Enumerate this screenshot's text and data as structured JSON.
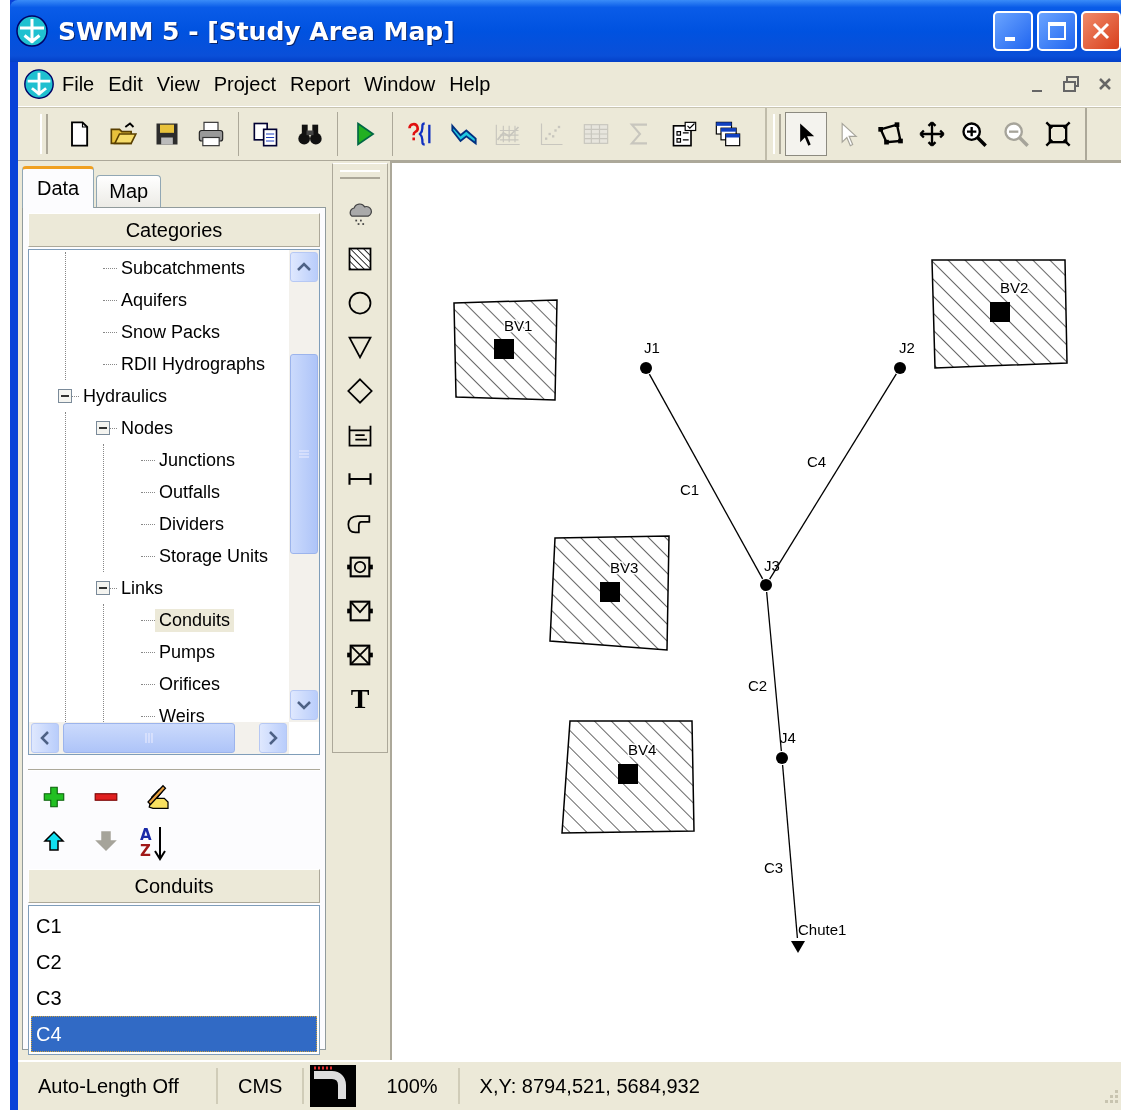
{
  "window": {
    "title": "SWMM 5 - [Study Area Map]"
  },
  "menu": {
    "items": [
      "File",
      "Edit",
      "View",
      "Project",
      "Report",
      "Window",
      "Help"
    ]
  },
  "standard_toolbar": [
    {
      "disabled": false
    },
    {
      "disabled": false
    },
    {
      "disabled": false
    },
    {
      "disabled": false
    },
    {
      "disabled": false
    },
    {
      "disabled": false
    },
    {
      "disabled": false
    },
    {
      "disabled": false
    },
    {
      "disabled": false
    },
    {
      "disabled": true
    },
    {
      "disabled": true
    },
    {
      "disabled": true
    },
    {
      "disabled": true
    },
    {
      "disabled": false
    },
    {
      "disabled": false
    }
  ],
  "map_toolbar": [
    {
      "disabled": false,
      "pressed": true
    },
    {
      "disabled": true,
      "pressed": false
    },
    {
      "disabled": false,
      "pressed": false
    },
    {
      "disabled": false,
      "pressed": false
    },
    {
      "disabled": false,
      "pressed": false
    },
    {
      "disabled": true,
      "pressed": false
    },
    {
      "disabled": false,
      "pressed": false
    }
  ],
  "browser": {
    "tabs": [
      {
        "label": "Data",
        "selected": true
      },
      {
        "label": "Map",
        "selected": false
      }
    ],
    "categories_header": "Categories",
    "tree": [
      {
        "children": [
          {
            "label": "Subcatchments",
            "selected": false
          },
          {
            "label": "Aquifers",
            "selected": false
          },
          {
            "label": "Snow Packs",
            "selected": false
          },
          {
            "label": "RDII Hydrographs",
            "selected": false
          }
        ]
      },
      {
        "label": "Hydraulics",
        "selected": false,
        "expanded": true,
        "children": [
          {
            "label": "Nodes",
            "selected": false,
            "expanded": true,
            "children": [
              {
                "label": "Junctions",
                "selected": false
              },
              {
                "label": "Outfalls",
                "selected": false
              },
              {
                "label": "Dividers",
                "selected": false
              },
              {
                "label": "Storage Units",
                "selected": false
              }
            ]
          },
          {
            "label": "Links",
            "selected": false,
            "expanded": true,
            "children": [
              {
                "label": "Conduits",
                "selected": true
              },
              {
                "label": "Pumps",
                "selected": false
              },
              {
                "label": "Orifices",
                "selected": false
              },
              {
                "label": "Weirs",
                "selected": false
              }
            ]
          }
        ]
      }
    ],
    "object_buttons": [
      {
        "kind": "add",
        "disabled": false
      },
      {
        "kind": "delete",
        "disabled": false
      },
      {
        "kind": "edit",
        "disabled": false
      },
      {
        "kind": "move_up",
        "disabled": false
      },
      {
        "kind": "move_down",
        "disabled": true
      },
      {
        "kind": "sort",
        "disabled": false,
        "letters": [
          "A",
          "Z"
        ]
      }
    ],
    "objects_header": "Conduits",
    "objects": [
      {
        "label": "C1",
        "selected": false
      },
      {
        "label": "C2",
        "selected": false
      },
      {
        "label": "C3",
        "selected": false
      },
      {
        "label": "C4",
        "selected": true
      }
    ]
  },
  "object_toolbar": {
    "label_tool": "T"
  },
  "map": {
    "subcatchments": [
      {
        "name": "BV1"
      },
      {
        "name": "BV2"
      },
      {
        "name": "BV3"
      },
      {
        "name": "BV4"
      }
    ],
    "nodes": [
      {
        "name": "J1",
        "kind": "junction"
      },
      {
        "name": "J2",
        "kind": "junction"
      },
      {
        "name": "J3",
        "kind": "junction"
      },
      {
        "name": "J4",
        "kind": "junction"
      },
      {
        "name": "Chute1",
        "kind": "outfall"
      }
    ],
    "links": [
      {
        "name": "C1"
      },
      {
        "name": "C2"
      },
      {
        "name": "C3"
      },
      {
        "name": "C4"
      }
    ]
  },
  "status_bar": {
    "auto_length": "Auto-Length Off",
    "flow_units": "CMS",
    "zoom": "100%",
    "coordinates": "X,Y: 8794,521, 5684,932"
  }
}
